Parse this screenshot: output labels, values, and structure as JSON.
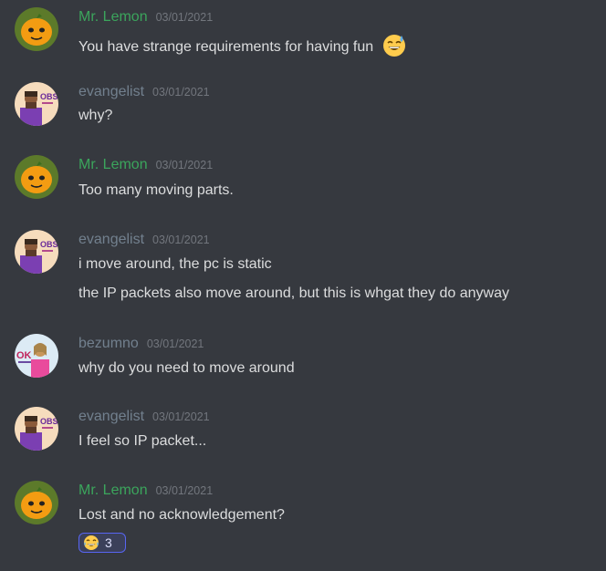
{
  "messages": [
    {
      "author": "Mr. Lemon",
      "timestamp": "03/01/2021",
      "lines": [
        "You have strange requirements for having fun"
      ],
      "avatar": "lemon-avatar",
      "emoji": "sweat-smile-emoji"
    },
    {
      "author": "evangelist",
      "timestamp": "03/01/2021",
      "lines": [
        "why?"
      ],
      "avatar": "evangelist-avatar"
    },
    {
      "author": "Mr. Lemon",
      "timestamp": "03/01/2021",
      "lines": [
        "Too many moving parts."
      ],
      "avatar": "lemon-avatar"
    },
    {
      "author": "evangelist",
      "timestamp": "03/01/2021",
      "lines": [
        "i move around, the pc is static",
        "the IP packets also move around, but this is whgat they do anyway"
      ],
      "avatar": "evangelist-avatar"
    },
    {
      "author": "bezumno",
      "timestamp": "03/01/2021",
      "lines": [
        "why do you need to move around"
      ],
      "avatar": "bezumno-avatar"
    },
    {
      "author": "evangelist",
      "timestamp": "03/01/2021",
      "lines": [
        "I feel so IP packet..."
      ],
      "avatar": "evangelist-avatar"
    },
    {
      "author": "Mr. Lemon",
      "timestamp": "03/01/2021",
      "lines": [
        "Lost and no acknowledgement?"
      ],
      "avatar": "lemon-avatar",
      "reaction": {
        "emoji": "joy-emoji",
        "count": "3"
      }
    }
  ],
  "avatar_text": {
    "obs": "OBS",
    "ok": "OK"
  },
  "colors": {
    "background": "#36393f",
    "lemon_name": "#3ba55c",
    "grey_name": "#72808e",
    "text": "#dcddde",
    "timestamp": "#72767d",
    "reaction_border": "#5865f2"
  }
}
